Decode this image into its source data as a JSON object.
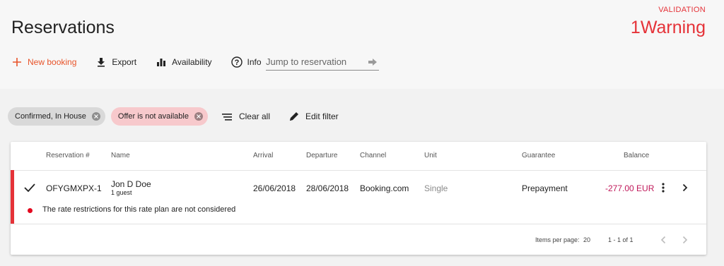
{
  "header": {
    "title": "Reservations",
    "validation_label": "VALIDATION",
    "warning_text": "1Warning"
  },
  "toolbar": {
    "new_booking": "New booking",
    "export": "Export",
    "availability": "Availability",
    "info": "Info",
    "jump_placeholder": "Jump to reservation"
  },
  "filters": {
    "chips": [
      "Confirmed, In House",
      "Offer is not available"
    ],
    "clear_all": "Clear all",
    "edit_filter": "Edit filter"
  },
  "table": {
    "columns": {
      "reservation": "Reservation #",
      "name": "Name",
      "arrival": "Arrival",
      "departure": "Departure",
      "channel": "Channel",
      "unit": "Unit",
      "guarantee": "Guarantee",
      "balance": "Balance"
    },
    "row": {
      "reservation": "OFYGMXPX-1",
      "name": "Jon D Doe",
      "guests": "1 guest",
      "arrival": "26/06/2018",
      "departure": "28/06/2018",
      "channel": "Booking.com",
      "unit": "Single",
      "guarantee": "Prepayment",
      "balance": "-277.00 EUR",
      "warning": "The rate restrictions for this rate plan are not considered"
    },
    "pagination": {
      "items_per_page_label": "Items per page:",
      "items_per_page_value": "20",
      "range": "1 - 1 of 1"
    }
  },
  "colors": {
    "warning_red": "#e53238",
    "accent_orange": "#e8542a",
    "negative_balance": "#c0185a"
  },
  "icons": [
    "plus-icon",
    "download-icon",
    "bar-chart-icon",
    "info-icon",
    "arrow-right-icon",
    "cancel-icon",
    "clear-all-icon",
    "pencil-icon",
    "checkmark-icon",
    "more-vert-icon",
    "chevron-right-icon",
    "chevron-left-icon"
  ]
}
